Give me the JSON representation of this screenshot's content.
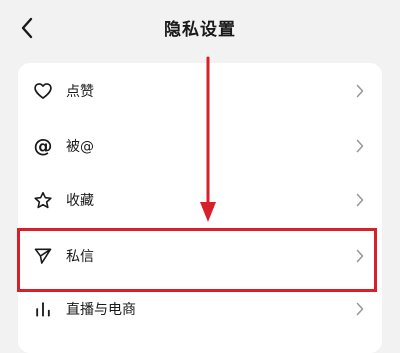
{
  "header": {
    "title": "隐私设置",
    "back_icon": "chevron-left-icon"
  },
  "menu": {
    "items": [
      {
        "label": "点赞",
        "icon": "heart-icon"
      },
      {
        "label": "被@",
        "icon": "at-icon"
      },
      {
        "label": "收藏",
        "icon": "star-icon"
      },
      {
        "label": "私信",
        "icon": "send-icon"
      },
      {
        "label": "直播与电商",
        "icon": "bar-chart-icon"
      }
    ]
  },
  "annotation": {
    "color": "#d8202a",
    "arrow_icon": "arrow-down-icon",
    "highlighted_item": "私信"
  }
}
